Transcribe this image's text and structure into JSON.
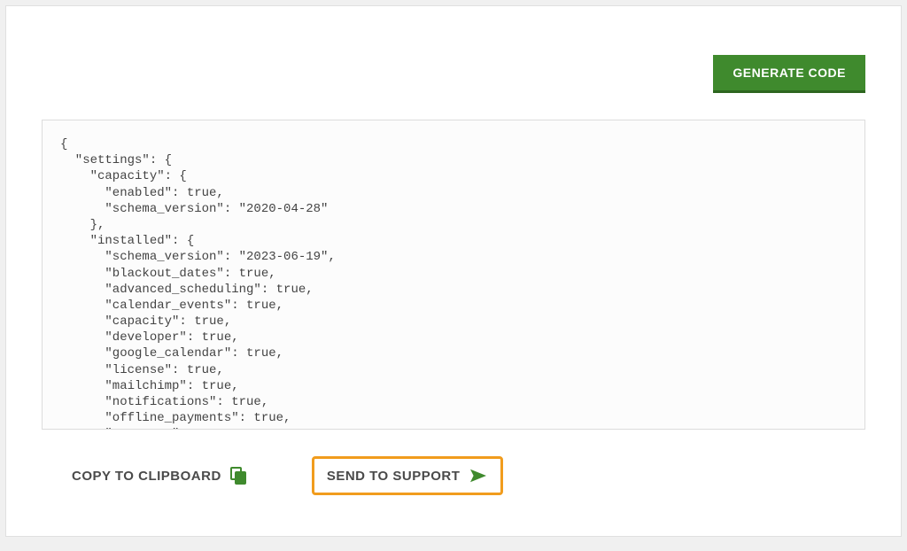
{
  "top": {
    "generate_label": "GENERATE CODE"
  },
  "code": {
    "text": "{\n  \"settings\": {\n    \"capacity\": {\n      \"enabled\": true,\n      \"schema_version\": \"2020-04-28\"\n    },\n    \"installed\": {\n      \"schema_version\": \"2023-06-19\",\n      \"blackout_dates\": true,\n      \"advanced_scheduling\": true,\n      \"calendar_events\": true,\n      \"capacity\": true,\n      \"developer\": true,\n      \"google_calendar\": true,\n      \"license\": true,\n      \"mailchimp\": true,\n      \"notifications\": true,\n      \"offline_payments\": true,\n      \"payments\": true,"
  },
  "bottom": {
    "copy_label": "COPY TO CLIPBOARD",
    "send_label": "SEND TO SUPPORT"
  },
  "colors": {
    "primary": "#3f8a2d",
    "highlight": "#f19c1d"
  }
}
